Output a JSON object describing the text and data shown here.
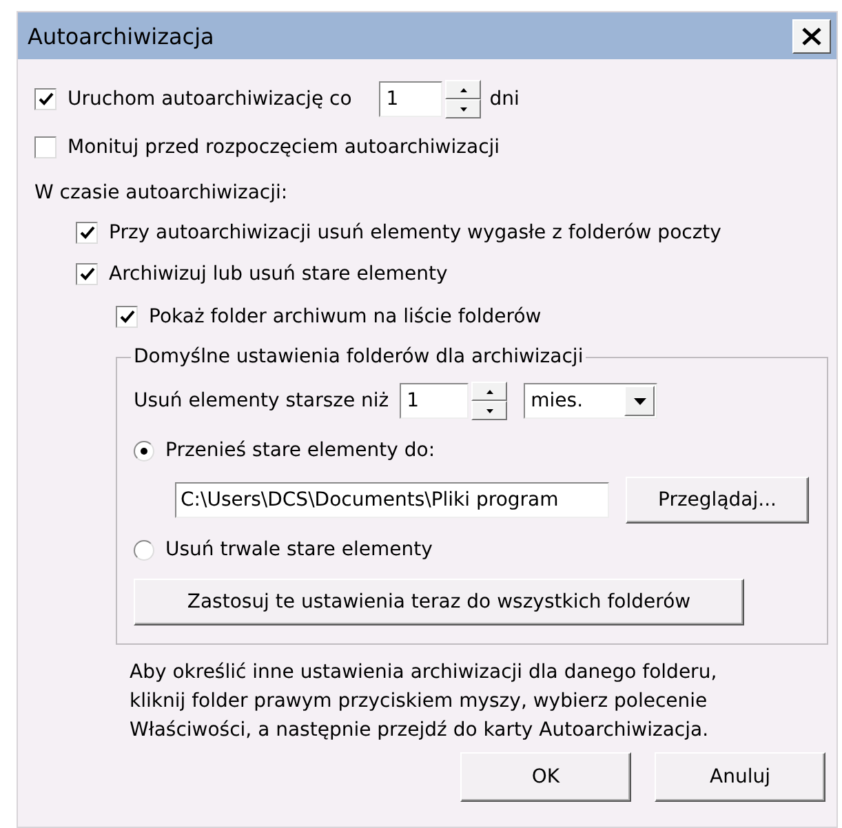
{
  "window": {
    "title": "Autoarchiwizacja"
  },
  "run_every": {
    "label": "Uruchom autoarchiwizację co",
    "checked": true,
    "value": "1",
    "unit": "dni"
  },
  "prompt": {
    "label": "Monituj przed rozpoczęciem autoarchiwizacji",
    "checked": false
  },
  "during_label": "W czasie autoarchiwizacji:",
  "options": [
    {
      "label": "Przy autoarchiwizacji usuń elementy wygasłe z folderów poczty",
      "checked": true
    },
    {
      "label": "Archiwizuj lub usuń stare elementy",
      "checked": true,
      "children": [
        {
          "label": "Pokaż folder archiwum na liście folderów",
          "checked": true
        }
      ]
    }
  ],
  "group": {
    "legend": "Domyślne ustawienia folderów dla archiwizacji",
    "older_than": {
      "label": "Usuń elementy starsze niż",
      "value": "1",
      "unit": "mies."
    },
    "choices": [
      {
        "label": "Przenieś stare elementy do:",
        "selected": true
      },
      {
        "label": "Usuń trwale stare elementy",
        "selected": false
      }
    ],
    "path": "C:\\Users\\DCS\\Documents\\Pliki program",
    "browse": "Przeglądaj...",
    "apply": "Zastosuj te ustawienia teraz do wszystkich folderów"
  },
  "note": "Aby określić inne ustawienia archiwizacji dla danego folderu,\nkliknij folder prawym przyciskiem myszy, wybierz polecenie\nWłaściwości, a następnie przejdź do karty Autoarchiwizacja.",
  "buttons": [
    "OK",
    "Anuluj"
  ]
}
